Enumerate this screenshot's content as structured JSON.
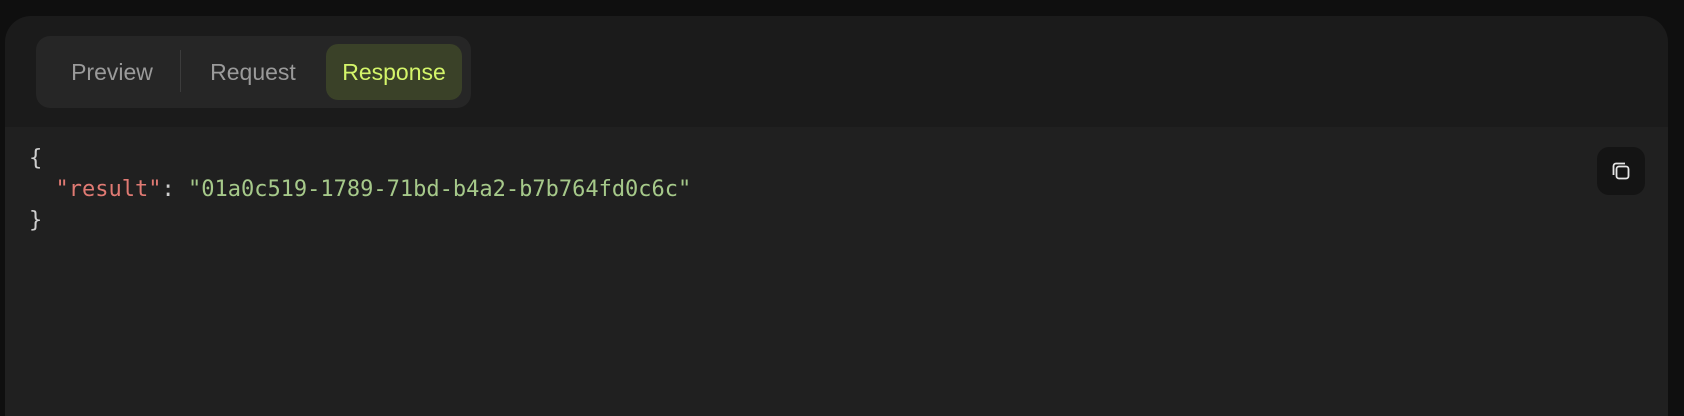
{
  "tabs": {
    "preview": "Preview",
    "request": "Request",
    "response": "Response",
    "active": "Response"
  },
  "response": {
    "open_brace": "{",
    "key": "\"result\"",
    "colon": ": ",
    "value": "\"01a0c519-1789-71bd-b4a2-b7b764fd0c6c\"",
    "close_brace": "}"
  },
  "icons": {
    "copy": "copy-icon"
  },
  "colors": {
    "accent": "#d4f56a",
    "active_tab_bg": "#3a4128",
    "json_key": "#e07a73",
    "json_string": "#a6c98a"
  }
}
